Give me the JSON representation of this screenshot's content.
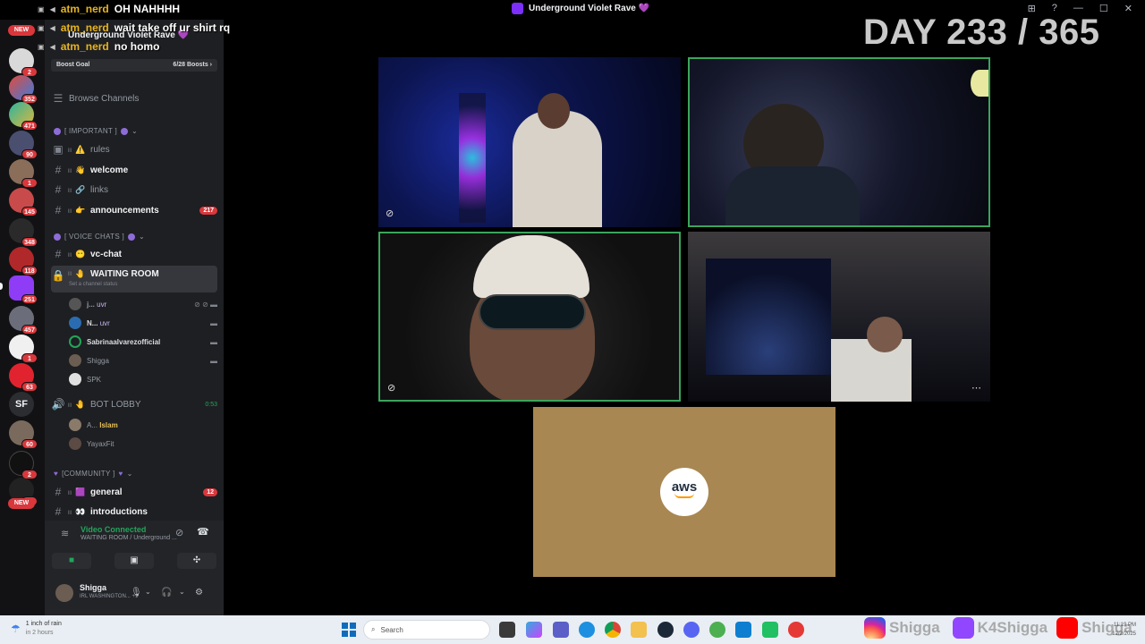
{
  "window": {
    "title": "Underground Violet Rave 💜",
    "controls": [
      "⊞",
      "?",
      "—",
      "☐",
      "✕"
    ]
  },
  "overlay": {
    "chat": [
      {
        "user": "atm_nerd",
        "message": "OH NAHHHH"
      },
      {
        "user": "atm_nerd",
        "message": "wait take off ur shirt rq"
      },
      {
        "user": "atm_nerd",
        "message": "no homo"
      }
    ],
    "day_counter": "DAY 233 / 365"
  },
  "rail": {
    "new_label": "NEW",
    "badges": [
      "2",
      "352",
      "471",
      "90",
      "1",
      "145",
      "348",
      "118",
      "251",
      "457",
      "1",
      "63",
      "60",
      "2",
      "20"
    ],
    "sf_label": "SF"
  },
  "sidebar": {
    "server_name": "Underground Violet Rave 💜",
    "boost_goal": "Boost Goal",
    "boosts": "6/28 Boosts ›",
    "browse": "Browse Channels",
    "categories": {
      "important": "[ IMPORTANT ]",
      "voice": "[ VOICE CHATS ]",
      "community": "[COMMUNITY ]"
    },
    "channels": {
      "rules": "rules",
      "welcome": "welcome",
      "links": "links",
      "announcements": "announcements",
      "announcements_count": "217",
      "vc_chat": "vc-chat",
      "waiting_room": "WAITING ROOM",
      "waiting_status": "Set a channel status",
      "bot_lobby": "BOT LOBBY",
      "bot_timer": "0:53",
      "general": "general",
      "general_count": "12",
      "introductions": "introductions"
    },
    "voice_users": [
      {
        "name": "j...",
        "tag": "uvr"
      },
      {
        "name": "N...",
        "tag": "uvr"
      },
      {
        "name": "Sabrinaalvarezofficial",
        "tag": ""
      },
      {
        "name": "Shigga",
        "tag": ""
      },
      {
        "name": "SPK",
        "tag": ""
      }
    ],
    "bot_users": [
      {
        "name": "A...",
        "tag": "Islam"
      },
      {
        "name": "YayaxFit",
        "tag": ""
      }
    ]
  },
  "voice_panel": {
    "status": "Video Connected",
    "location": "WAITING ROOM / Underground ..."
  },
  "user_panel": {
    "name": "Shigga",
    "status": "IRL WASHINGTON... +1"
  },
  "sponsor": {
    "logo_text": "aws"
  },
  "taskbar": {
    "weather_line1": "1 inch of rain",
    "weather_line2": "in 2 hours",
    "search_placeholder": "Search",
    "socials": [
      "Shigga",
      "K4Shigga",
      "Shigga"
    ],
    "tray_time": "11:19 PM",
    "tray_date": "12/2/2025"
  },
  "colors": {
    "accent_purple": "#8e6cd8",
    "speaking_green": "#3ba55c",
    "badge_red": "#da373c",
    "chat_user": "#e6b422"
  }
}
